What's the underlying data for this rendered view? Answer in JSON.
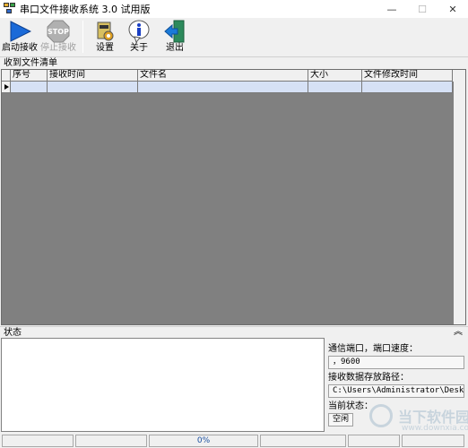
{
  "window": {
    "title": "串口文件接收系统 3.0 试用版",
    "minimize_glyph": "—",
    "maximize_glyph": "☐",
    "close_glyph": "✕"
  },
  "toolbar": {
    "start_label": "启动接收",
    "stop_label": "停止接收",
    "stop_icon_text": "STOP",
    "settings_label": "设置",
    "about_label": "关于",
    "exit_label": "退出"
  },
  "file_list": {
    "title": "收到文件清单",
    "columns": [
      "序号",
      "接收时间",
      "文件名",
      "大小",
      "文件修改时间"
    ],
    "rows": [
      [
        "",
        "",
        "",
        "",
        ""
      ]
    ]
  },
  "status_panel": {
    "title": "状态",
    "collapse_glyph": "︽",
    "port_label": "通信端口，端口速度：",
    "port_value": "，9600",
    "path_label": "接收数据存放路径：",
    "path_value": "C:\\Users\\Administrator\\Deskto",
    "state_label": "当前状态：",
    "state_value": "空闲"
  },
  "statusbar": {
    "parts": [
      "",
      "",
      "0%",
      "",
      "",
      ""
    ]
  },
  "watermark": {
    "text": "当下软件园",
    "url": "www.downxia.com"
  },
  "colors": {
    "selected_row": "#d6e1f5",
    "grid_background": "#808080",
    "start_icon": "#1b6ad8",
    "stop_icon": "#b0b0b0",
    "about_icon": "#1a3fc4",
    "exit_icon": "#2c8a5c",
    "progress_text": "#1a4fa0"
  }
}
